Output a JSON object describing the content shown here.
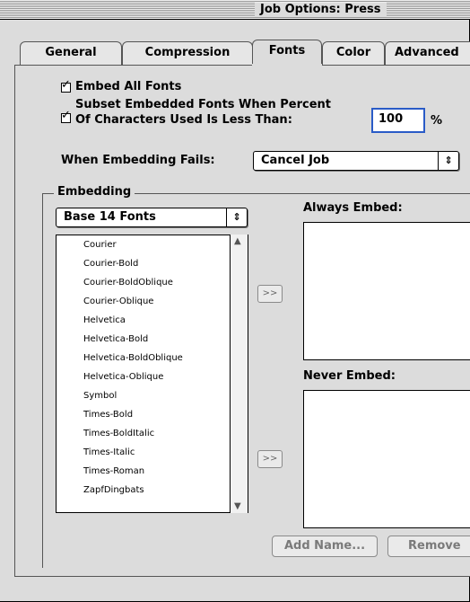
{
  "window": {
    "title": "Job Options: Press"
  },
  "tabs": [
    {
      "label": "General"
    },
    {
      "label": "Compression"
    },
    {
      "label": "Fonts"
    },
    {
      "label": "Color"
    },
    {
      "label": "Advanced"
    }
  ],
  "options": {
    "embed_all_fonts": {
      "label": "Embed All Fonts",
      "checked": true
    },
    "subset": {
      "label_line1": "Subset Embedded Fonts When Percent",
      "label_line2": "Of Characters Used Is Less Than:",
      "checked": true,
      "value": "100",
      "unit": "%"
    },
    "when_embedding_fails": {
      "label": "When Embedding Fails:",
      "selected": "Cancel Job"
    }
  },
  "embedding": {
    "group_label": "Embedding",
    "font_source_selected": "Base 14 Fonts",
    "fonts": [
      "Courier",
      "Courier-Bold",
      "Courier-BoldOblique",
      "Courier-Oblique",
      "Helvetica",
      "Helvetica-Bold",
      "Helvetica-BoldOblique",
      "Helvetica-Oblique",
      "Symbol",
      "Times-Bold",
      "Times-BoldItalic",
      "Times-Italic",
      "Times-Roman",
      "ZapfDingbats"
    ],
    "move_button_label": ">>",
    "always_embed_label": "Always Embed:",
    "never_embed_label": "Never Embed:",
    "add_name_label": "Add Name...",
    "remove_label": "Remove"
  }
}
